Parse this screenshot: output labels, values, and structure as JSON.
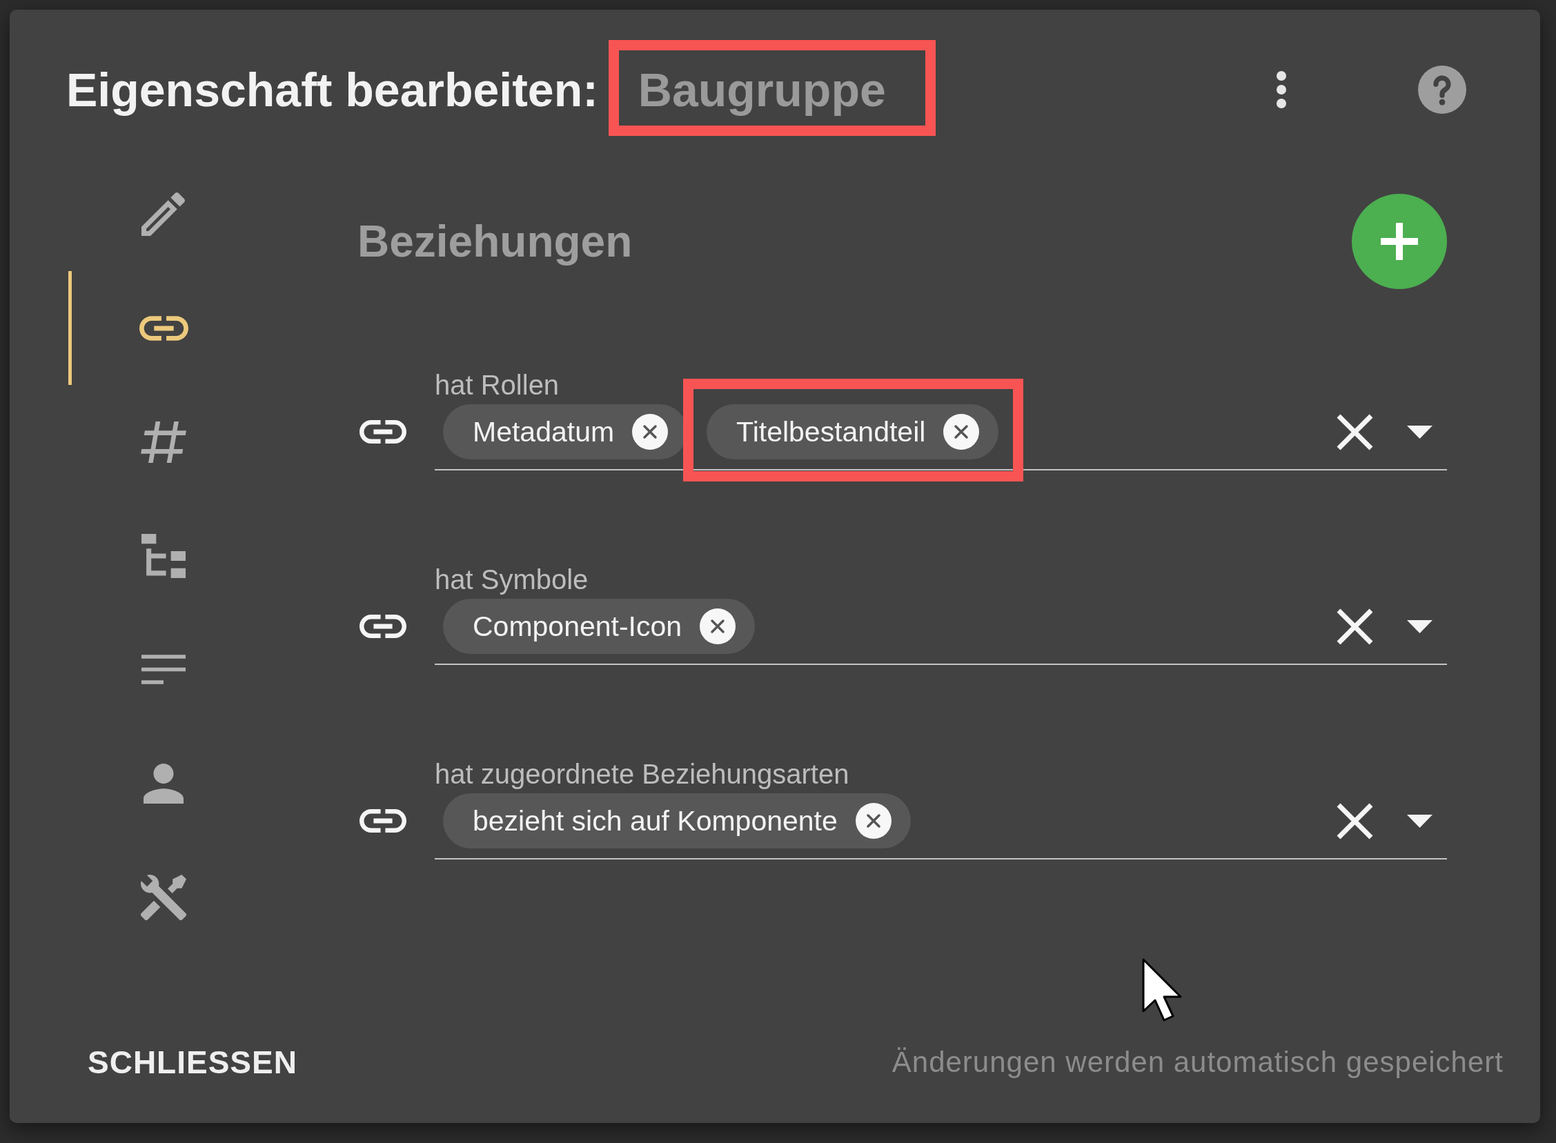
{
  "dialog": {
    "title": "Eigenschaft bearbeiten:",
    "subject": {
      "text": "Baugruppe",
      "highlighted": true
    }
  },
  "sidebar": {
    "items": [
      {
        "kind": "edit",
        "selected": false
      },
      {
        "kind": "relations",
        "selected": true
      },
      {
        "kind": "number",
        "selected": false
      },
      {
        "kind": "tree",
        "selected": false
      },
      {
        "kind": "text",
        "selected": false
      },
      {
        "kind": "person",
        "selected": false
      },
      {
        "kind": "tools",
        "selected": false
      }
    ]
  },
  "section": {
    "title": "Beziehungen"
  },
  "relations": [
    {
      "label": "hat Rollen",
      "chips": [
        {
          "label": "Metadatum",
          "highlighted": false
        },
        {
          "label": "Titelbestandteil",
          "highlighted": true
        }
      ]
    },
    {
      "label": "hat Symbole",
      "chips": [
        {
          "label": "Component-Icon",
          "highlighted": false
        }
      ]
    },
    {
      "label": "hat zugeordnete Beziehungsarten",
      "chips": [
        {
          "label": "bezieht sich auf Komponente",
          "highlighted": false
        }
      ]
    }
  ],
  "footer": {
    "close_button": "SCHLIESSEN",
    "status": "Änderungen werden automatisch gespeichert"
  }
}
